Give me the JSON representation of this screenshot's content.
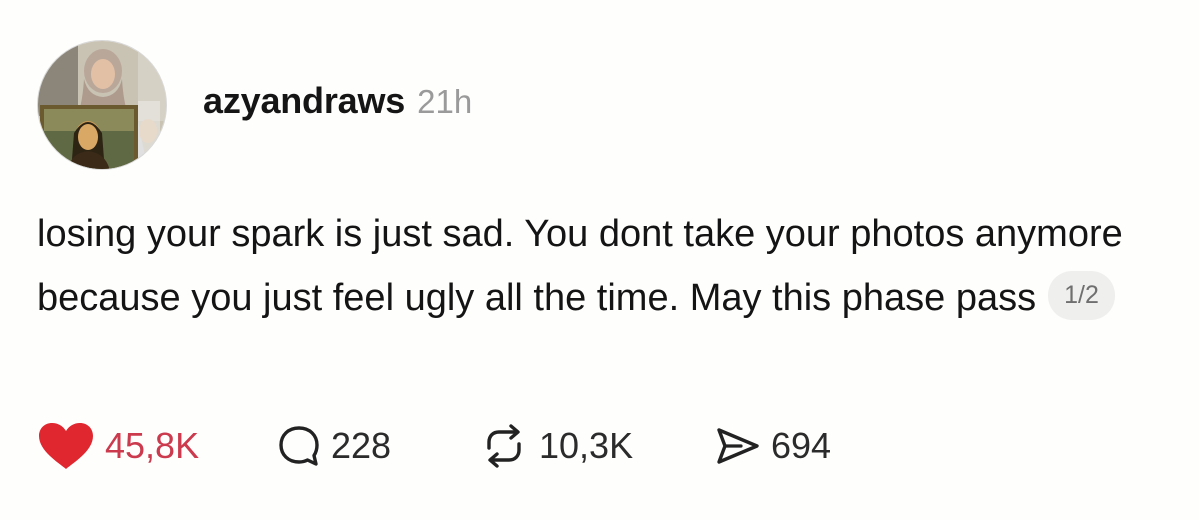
{
  "post": {
    "author": {
      "username": "azyandraws",
      "time_ago": "21h"
    },
    "text": "losing your spark is just sad. You dont take your photos anymore because you just feel ugly all the time. May this phase pass",
    "page_indicator": "1/2",
    "actions": {
      "likes": "45,8K",
      "replies": "228",
      "reposts": "10,3K",
      "shares": "694"
    }
  },
  "colors": {
    "like": "#e0262f",
    "like_text": "#cc3a4d",
    "secondary_text": "#9a9a9a",
    "background": "#fefefd"
  },
  "icons": {
    "like": "heart-icon",
    "reply": "speech-bubble-icon",
    "repost": "repost-arrows-icon",
    "share": "paper-plane-icon"
  }
}
